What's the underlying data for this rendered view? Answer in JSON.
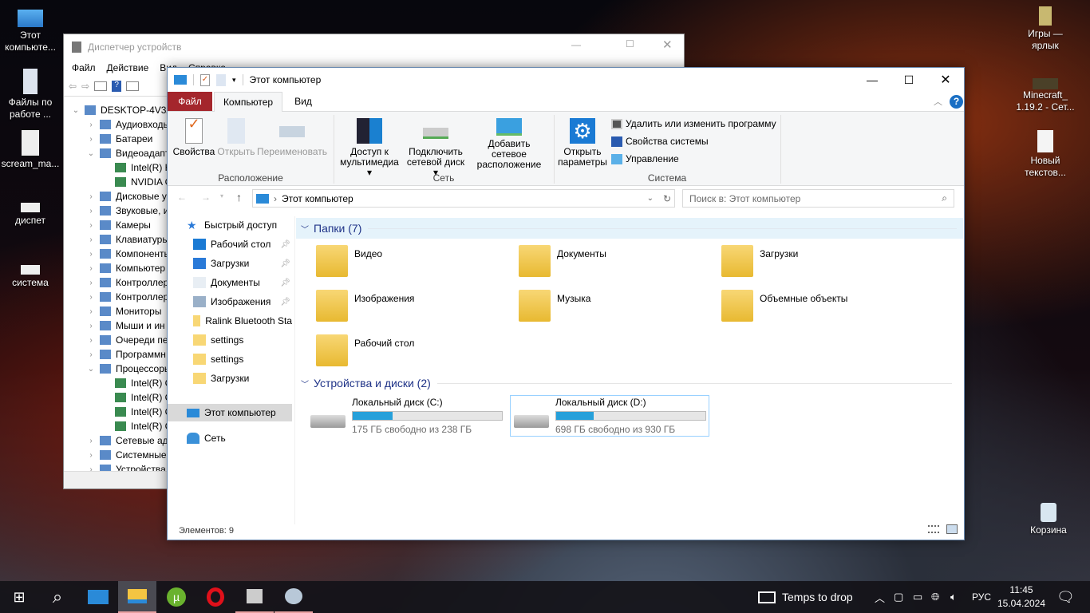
{
  "desktop": {
    "left_icons": [
      "Этот компьюте...",
      "Файлы по работе ...",
      "scream_ma...",
      "диспет",
      "система"
    ],
    "right_icons": [
      "Игры — ярлык",
      "Minecraft_ 1.19.2 - Сет...",
      "Новый текстов...",
      "Корзина"
    ]
  },
  "device_manager": {
    "title": "Диспетчер устройств",
    "menu": [
      "Файл",
      "Действие",
      "Вид",
      "Справка"
    ],
    "tree": [
      {
        "label": "DESKTOP-4V3AE",
        "level": 0,
        "expanded": true
      },
      {
        "label": "Аудиовходы",
        "level": 1
      },
      {
        "label": "Батареи",
        "level": 1
      },
      {
        "label": "Видеоадаптеры",
        "level": 1,
        "expanded": true
      },
      {
        "label": "Intel(R) H",
        "level": 2
      },
      {
        "label": "NVIDIA G",
        "level": 2
      },
      {
        "label": "Дисковые у",
        "level": 1
      },
      {
        "label": "Звуковые, и",
        "level": 1
      },
      {
        "label": "Камеры",
        "level": 1
      },
      {
        "label": "Клавиатуры",
        "level": 1
      },
      {
        "label": "Компоненты",
        "level": 1
      },
      {
        "label": "Компьютер",
        "level": 1
      },
      {
        "label": "Контроллеры",
        "level": 1
      },
      {
        "label": "Контроллеры",
        "level": 1
      },
      {
        "label": "Мониторы",
        "level": 1
      },
      {
        "label": "Мыши и ин",
        "level": 1
      },
      {
        "label": "Очереди печ",
        "level": 1
      },
      {
        "label": "Программн",
        "level": 1
      },
      {
        "label": "Процессоры",
        "level": 1,
        "expanded": true
      },
      {
        "label": "Intel(R) C",
        "level": 2
      },
      {
        "label": "Intel(R) C",
        "level": 2
      },
      {
        "label": "Intel(R) C",
        "level": 2
      },
      {
        "label": "Intel(R) C",
        "level": 2
      },
      {
        "label": "Сетевые ада",
        "level": 1
      },
      {
        "label": "Системные",
        "level": 1
      },
      {
        "label": "Устройства",
        "level": 1
      }
    ]
  },
  "explorer": {
    "title": "Этот компьютер",
    "tabs": [
      "Файл",
      "Компьютер",
      "Вид"
    ],
    "active_tab": "Компьютер",
    "file_tab_color": "#a4262c",
    "ribbon": {
      "location": {
        "label": "Расположение",
        "buttons": [
          "Свойства",
          "Открыть",
          "Переименовать"
        ]
      },
      "network": {
        "label": "Сеть",
        "buttons": [
          "Доступ к мультимедиа",
          "Подключить сетевой диск",
          "Добавить сетевое расположение"
        ]
      },
      "system": {
        "label": "Система",
        "open_settings": "Открыть параметры",
        "items": [
          "Удалить или изменить программу",
          "Свойства системы",
          "Управление"
        ]
      }
    },
    "address": "Этот компьютер",
    "search_placeholder": "Поиск в: Этот компьютер",
    "nav": {
      "quick_access": "Быстрый доступ",
      "items": [
        {
          "label": "Рабочий стол",
          "pinned": true
        },
        {
          "label": "Загрузки",
          "pinned": true
        },
        {
          "label": "Документы",
          "pinned": true
        },
        {
          "label": "Изображения",
          "pinned": true
        },
        {
          "label": "Ralink Bluetooth Sta"
        },
        {
          "label": "settings"
        },
        {
          "label": "settings"
        },
        {
          "label": "Загрузки"
        }
      ],
      "this_pc": "Этот компьютер",
      "network": "Сеть"
    },
    "folders_header": "Папки (7)",
    "folders": [
      "Видео",
      "Документы",
      "Загрузки",
      "Изображения",
      "Музыка",
      "Объемные объекты",
      "Рабочий стол"
    ],
    "devices_header": "Устройства и диски (2)",
    "drives": [
      {
        "name": "Локальный диск (C:)",
        "free": "175 ГБ свободно из 238 ГБ",
        "used_percent": 26.5
      },
      {
        "name": "Локальный диск (D:)",
        "free": "698 ГБ свободно из 930 ГБ",
        "used_percent": 25,
        "selected": true
      }
    ],
    "status": "Элементов: 9"
  },
  "taskbar": {
    "weather": "Temps to drop",
    "lang": "РУС",
    "time": "11:45",
    "date": "15.04.2024"
  }
}
